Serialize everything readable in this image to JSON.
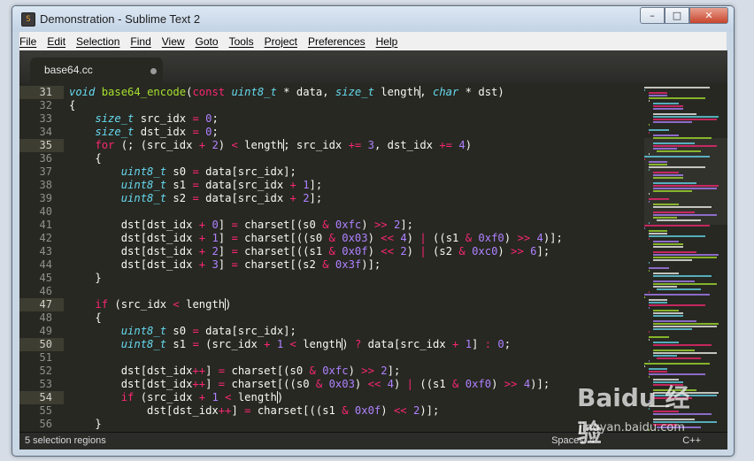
{
  "window": {
    "title": "Demonstration - Sublime Text 2",
    "app_icon_glyph": "S",
    "controls": {
      "minimize": "–",
      "maximize": "□",
      "close": "✕"
    }
  },
  "menu": [
    "File",
    "Edit",
    "Selection",
    "Find",
    "View",
    "Goto",
    "Tools",
    "Project",
    "Preferences",
    "Help"
  ],
  "tab": {
    "filename": "base64.cc",
    "modified": true
  },
  "editor": {
    "highlighted_lines": [
      31,
      35,
      47,
      50,
      54
    ],
    "lines": [
      {
        "n": 31,
        "tokens": [
          [
            "ty",
            "void"
          ],
          [
            "p",
            " "
          ],
          [
            "fn",
            "base64_encode"
          ],
          [
            "p",
            "("
          ],
          [
            "kw",
            "const"
          ],
          [
            "p",
            " "
          ],
          [
            "ty",
            "uint8_t"
          ],
          [
            "p",
            " * data, "
          ],
          [
            "ty",
            "size_t"
          ],
          [
            "p",
            " length"
          ],
          [
            "c",
            ""
          ],
          [
            "p",
            ", "
          ],
          [
            "ty",
            "char"
          ],
          [
            "p",
            " * dst)"
          ]
        ]
      },
      {
        "n": 32,
        "tokens": [
          [
            "p",
            "{"
          ]
        ]
      },
      {
        "n": 33,
        "tokens": [
          [
            "p",
            "    "
          ],
          [
            "ty",
            "size_t"
          ],
          [
            "p",
            " src_idx "
          ],
          [
            "kw",
            "="
          ],
          [
            "p",
            " "
          ],
          [
            "nu",
            "0"
          ],
          [
            "p",
            ";"
          ]
        ]
      },
      {
        "n": 34,
        "tokens": [
          [
            "p",
            "    "
          ],
          [
            "ty",
            "size_t"
          ],
          [
            "p",
            " dst_idx "
          ],
          [
            "kw",
            "="
          ],
          [
            "p",
            " "
          ],
          [
            "nu",
            "0"
          ],
          [
            "p",
            ";"
          ]
        ]
      },
      {
        "n": 35,
        "tokens": [
          [
            "p",
            "    "
          ],
          [
            "kw",
            "for"
          ],
          [
            "p",
            " (; (src_idx "
          ],
          [
            "kw",
            "+"
          ],
          [
            "p",
            " "
          ],
          [
            "nu",
            "2"
          ],
          [
            "p",
            ") "
          ],
          [
            "kw",
            "<"
          ],
          [
            "p",
            " length"
          ],
          [
            "c",
            ""
          ],
          [
            "p",
            "; src_idx "
          ],
          [
            "kw",
            "+="
          ],
          [
            "p",
            " "
          ],
          [
            "nu",
            "3"
          ],
          [
            "p",
            ", dst_idx "
          ],
          [
            "kw",
            "+="
          ],
          [
            "p",
            " "
          ],
          [
            "nu",
            "4"
          ],
          [
            "p",
            ")"
          ]
        ]
      },
      {
        "n": 36,
        "tokens": [
          [
            "p",
            "    {"
          ]
        ]
      },
      {
        "n": 37,
        "tokens": [
          [
            "p",
            "        "
          ],
          [
            "ty",
            "uint8_t"
          ],
          [
            "p",
            " s0 "
          ],
          [
            "kw",
            "="
          ],
          [
            "p",
            " data[src_idx];"
          ]
        ]
      },
      {
        "n": 38,
        "tokens": [
          [
            "p",
            "        "
          ],
          [
            "ty",
            "uint8_t"
          ],
          [
            "p",
            " s1 "
          ],
          [
            "kw",
            "="
          ],
          [
            "p",
            " data[src_idx "
          ],
          [
            "kw",
            "+"
          ],
          [
            "p",
            " "
          ],
          [
            "nu",
            "1"
          ],
          [
            "p",
            "];"
          ]
        ]
      },
      {
        "n": 39,
        "tokens": [
          [
            "p",
            "        "
          ],
          [
            "ty",
            "uint8_t"
          ],
          [
            "p",
            " s2 "
          ],
          [
            "kw",
            "="
          ],
          [
            "p",
            " data[src_idx "
          ],
          [
            "kw",
            "+"
          ],
          [
            "p",
            " "
          ],
          [
            "nu",
            "2"
          ],
          [
            "p",
            "];"
          ]
        ]
      },
      {
        "n": 40,
        "tokens": []
      },
      {
        "n": 41,
        "tokens": [
          [
            "p",
            "        dst[dst_idx "
          ],
          [
            "kw",
            "+"
          ],
          [
            "p",
            " "
          ],
          [
            "nu",
            "0"
          ],
          [
            "p",
            "] "
          ],
          [
            "kw",
            "="
          ],
          [
            "p",
            " charset[(s0 "
          ],
          [
            "kw",
            "&"
          ],
          [
            "p",
            " "
          ],
          [
            "nu",
            "0xfc"
          ],
          [
            "p",
            ") "
          ],
          [
            "kw",
            ">>"
          ],
          [
            "p",
            " "
          ],
          [
            "nu",
            "2"
          ],
          [
            "p",
            "];"
          ]
        ]
      },
      {
        "n": 42,
        "tokens": [
          [
            "p",
            "        dst[dst_idx "
          ],
          [
            "kw",
            "+"
          ],
          [
            "p",
            " "
          ],
          [
            "nu",
            "1"
          ],
          [
            "p",
            "] "
          ],
          [
            "kw",
            "="
          ],
          [
            "p",
            " charset[((s0 "
          ],
          [
            "kw",
            "&"
          ],
          [
            "p",
            " "
          ],
          [
            "nu",
            "0x03"
          ],
          [
            "p",
            ") "
          ],
          [
            "kw",
            "<<"
          ],
          [
            "p",
            " "
          ],
          [
            "nu",
            "4"
          ],
          [
            "p",
            ") "
          ],
          [
            "kw",
            "|"
          ],
          [
            "p",
            " ((s1 "
          ],
          [
            "kw",
            "&"
          ],
          [
            "p",
            " "
          ],
          [
            "nu",
            "0xf0"
          ],
          [
            "p",
            ") "
          ],
          [
            "kw",
            ">>"
          ],
          [
            "p",
            " "
          ],
          [
            "nu",
            "4"
          ],
          [
            "p",
            ")];"
          ]
        ]
      },
      {
        "n": 43,
        "tokens": [
          [
            "p",
            "        dst[dst_idx "
          ],
          [
            "kw",
            "+"
          ],
          [
            "p",
            " "
          ],
          [
            "nu",
            "2"
          ],
          [
            "p",
            "] "
          ],
          [
            "kw",
            "="
          ],
          [
            "p",
            " charset[((s1 "
          ],
          [
            "kw",
            "&"
          ],
          [
            "p",
            " "
          ],
          [
            "nu",
            "0x0f"
          ],
          [
            "p",
            ") "
          ],
          [
            "kw",
            "<<"
          ],
          [
            "p",
            " "
          ],
          [
            "nu",
            "2"
          ],
          [
            "p",
            ") "
          ],
          [
            "kw",
            "|"
          ],
          [
            "p",
            " (s2 "
          ],
          [
            "kw",
            "&"
          ],
          [
            "p",
            " "
          ],
          [
            "nu",
            "0xc0"
          ],
          [
            "p",
            ") "
          ],
          [
            "kw",
            ">>"
          ],
          [
            "p",
            " "
          ],
          [
            "nu",
            "6"
          ],
          [
            "p",
            "];"
          ]
        ]
      },
      {
        "n": 44,
        "tokens": [
          [
            "p",
            "        dst[dst_idx "
          ],
          [
            "kw",
            "+"
          ],
          [
            "p",
            " "
          ],
          [
            "nu",
            "3"
          ],
          [
            "p",
            "] "
          ],
          [
            "kw",
            "="
          ],
          [
            "p",
            " charset[(s2 "
          ],
          [
            "kw",
            "&"
          ],
          [
            "p",
            " "
          ],
          [
            "nu",
            "0x3f"
          ],
          [
            "p",
            ")];"
          ]
        ]
      },
      {
        "n": 45,
        "tokens": [
          [
            "p",
            "    }"
          ]
        ]
      },
      {
        "n": 46,
        "tokens": []
      },
      {
        "n": 47,
        "tokens": [
          [
            "p",
            "    "
          ],
          [
            "kw",
            "if"
          ],
          [
            "p",
            " (src_idx "
          ],
          [
            "kw",
            "<"
          ],
          [
            "p",
            " length"
          ],
          [
            "c",
            ""
          ],
          [
            "p",
            ")"
          ]
        ]
      },
      {
        "n": 48,
        "tokens": [
          [
            "p",
            "    {"
          ]
        ]
      },
      {
        "n": 49,
        "tokens": [
          [
            "p",
            "        "
          ],
          [
            "ty",
            "uint8_t"
          ],
          [
            "p",
            " s0 "
          ],
          [
            "kw",
            "="
          ],
          [
            "p",
            " data[src_idx];"
          ]
        ]
      },
      {
        "n": 50,
        "tokens": [
          [
            "p",
            "        "
          ],
          [
            "ty",
            "uint8_t"
          ],
          [
            "p",
            " s1 "
          ],
          [
            "kw",
            "="
          ],
          [
            "p",
            " (src_idx "
          ],
          [
            "kw",
            "+"
          ],
          [
            "p",
            " "
          ],
          [
            "nu",
            "1"
          ],
          [
            "p",
            " "
          ],
          [
            "kw",
            "<"
          ],
          [
            "p",
            " length"
          ],
          [
            "c",
            ""
          ],
          [
            "p",
            ") "
          ],
          [
            "kw",
            "?"
          ],
          [
            "p",
            " data[src_idx "
          ],
          [
            "kw",
            "+"
          ],
          [
            "p",
            " "
          ],
          [
            "nu",
            "1"
          ],
          [
            "p",
            "] "
          ],
          [
            "kw",
            ":"
          ],
          [
            "p",
            " "
          ],
          [
            "nu",
            "0"
          ],
          [
            "p",
            ";"
          ]
        ]
      },
      {
        "n": 51,
        "tokens": []
      },
      {
        "n": 52,
        "tokens": [
          [
            "p",
            "        dst[dst_idx"
          ],
          [
            "kw",
            "++"
          ],
          [
            "p",
            "] "
          ],
          [
            "kw",
            "="
          ],
          [
            "p",
            " charset[(s0 "
          ],
          [
            "kw",
            "&"
          ],
          [
            "p",
            " "
          ],
          [
            "nu",
            "0xfc"
          ],
          [
            "p",
            ") "
          ],
          [
            "kw",
            ">>"
          ],
          [
            "p",
            " "
          ],
          [
            "nu",
            "2"
          ],
          [
            "p",
            "];"
          ]
        ]
      },
      {
        "n": 53,
        "tokens": [
          [
            "p",
            "        dst[dst_idx"
          ],
          [
            "kw",
            "++"
          ],
          [
            "p",
            "] "
          ],
          [
            "kw",
            "="
          ],
          [
            "p",
            " charset[((s0 "
          ],
          [
            "kw",
            "&"
          ],
          [
            "p",
            " "
          ],
          [
            "nu",
            "0x03"
          ],
          [
            "p",
            ") "
          ],
          [
            "kw",
            "<<"
          ],
          [
            "p",
            " "
          ],
          [
            "nu",
            "4"
          ],
          [
            "p",
            ") "
          ],
          [
            "kw",
            "|"
          ],
          [
            "p",
            " ((s1 "
          ],
          [
            "kw",
            "&"
          ],
          [
            "p",
            " "
          ],
          [
            "nu",
            "0xf0"
          ],
          [
            "p",
            ") "
          ],
          [
            "kw",
            ">>"
          ],
          [
            "p",
            " "
          ],
          [
            "nu",
            "4"
          ],
          [
            "p",
            ")];"
          ]
        ]
      },
      {
        "n": 54,
        "tokens": [
          [
            "p",
            "        "
          ],
          [
            "kw",
            "if"
          ],
          [
            "p",
            " (src_idx "
          ],
          [
            "kw",
            "+"
          ],
          [
            "p",
            " "
          ],
          [
            "nu",
            "1"
          ],
          [
            "p",
            " "
          ],
          [
            "kw",
            "<"
          ],
          [
            "p",
            " length"
          ],
          [
            "c",
            ""
          ],
          [
            "p",
            ")"
          ]
        ]
      },
      {
        "n": 55,
        "tokens": [
          [
            "p",
            "            dst[dst_idx"
          ],
          [
            "kw",
            "++"
          ],
          [
            "p",
            "] "
          ],
          [
            "kw",
            "="
          ],
          [
            "p",
            " charset[((s1 "
          ],
          [
            "kw",
            "&"
          ],
          [
            "p",
            " "
          ],
          [
            "nu",
            "0x0f"
          ],
          [
            "p",
            ") "
          ],
          [
            "kw",
            "<<"
          ],
          [
            "p",
            " "
          ],
          [
            "nu",
            "2"
          ],
          [
            "p",
            ")];"
          ]
        ]
      },
      {
        "n": 56,
        "tokens": [
          [
            "p",
            "    }"
          ]
        ]
      }
    ]
  },
  "status": {
    "selection": "5 selection regions",
    "spaces": "Spaces: 4",
    "syntax": "C++"
  },
  "watermark": {
    "logo": "Bai⁠du 经验",
    "url": "jingyan.baidu.com"
  },
  "colors": {
    "background": "#272822",
    "keyword": "#f92672",
    "type": "#66d9ef",
    "function": "#a6e22e",
    "number": "#ae81ff",
    "text": "#f8f8f2",
    "line_number": "#8f908a"
  }
}
